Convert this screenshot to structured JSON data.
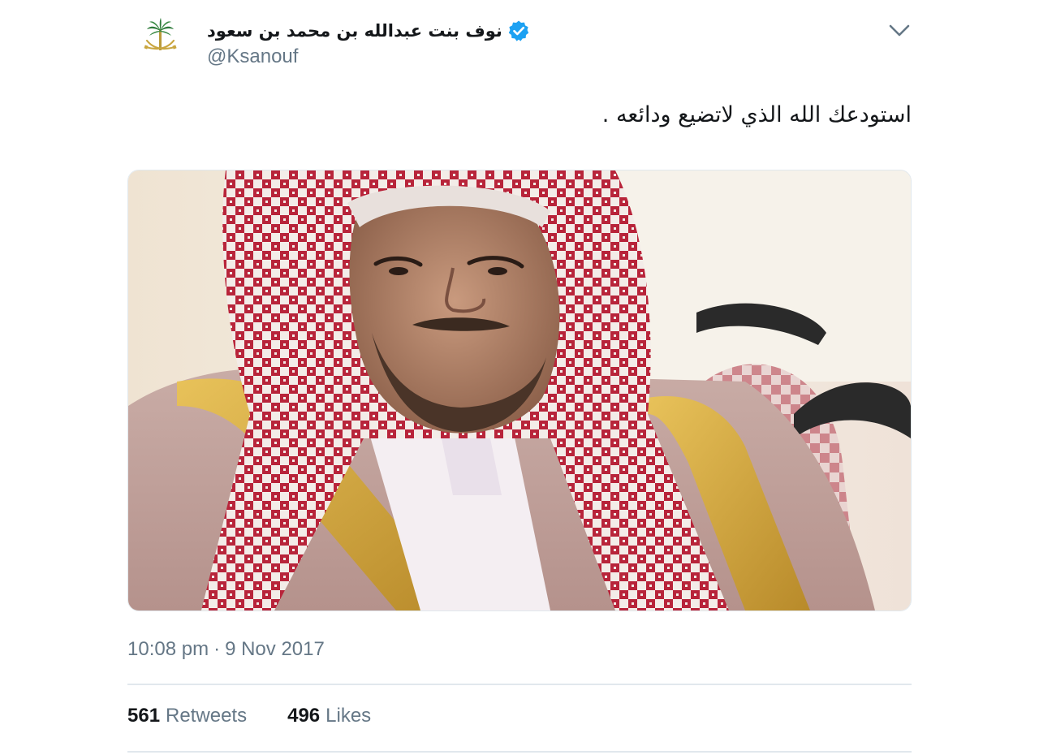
{
  "author": {
    "display_name": "نوف بنت عبدالله بن محمد بن سعود",
    "handle": "@Ksanouf",
    "avatar_caption": "نوف بنت عبدالله",
    "verified": true,
    "verified_color": "#1da1f2"
  },
  "tweet": {
    "text": "استودعك الله الذي لاتضيع ودائعه .",
    "time": "10:08 pm",
    "separator": "·",
    "date": "9 Nov 2017"
  },
  "stats": {
    "retweets_count": "561",
    "retweets_label": "Retweets",
    "likes_count": "496",
    "likes_label": "Likes"
  },
  "icons": {
    "menu": "chevron-down-icon",
    "verified": "verified-badge-icon"
  },
  "colors": {
    "text_primary": "#14171a",
    "text_secondary": "#657786",
    "divider": "#e1e8ed",
    "logo_gold": "#c9a640",
    "logo_green": "#2d7a3a"
  }
}
